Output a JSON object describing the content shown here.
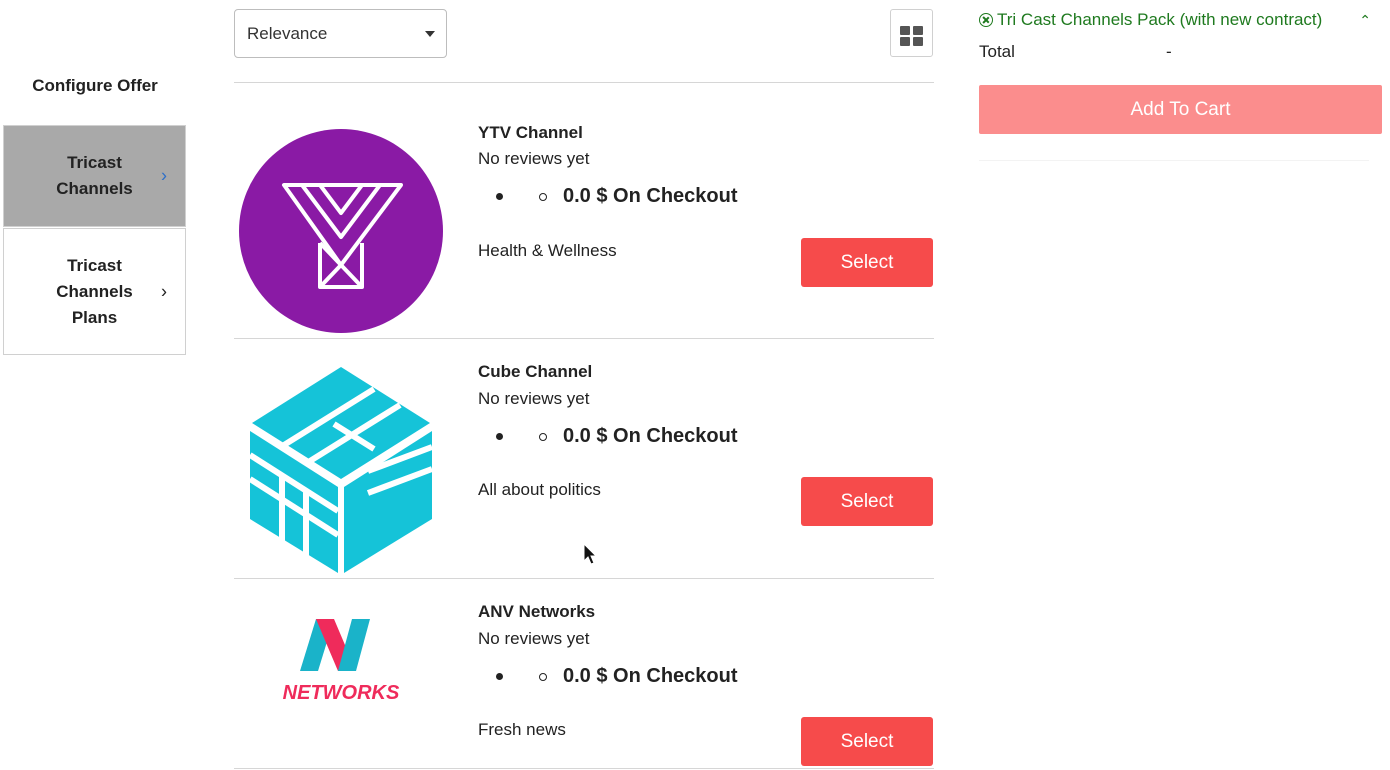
{
  "sidebar": {
    "title": "Configure Offer",
    "items": [
      {
        "label": "Tricast Channels",
        "active": true
      },
      {
        "label": "Tricast Channels Plans",
        "active": false
      }
    ]
  },
  "toolbar": {
    "sort_value": "Relevance",
    "view_icon": "grid-view-icon"
  },
  "products": [
    {
      "name": "YTV Channel",
      "reviews": "No reviews yet",
      "price": "0.0 $ On Checkout",
      "description": "Health & Wellness",
      "select_label": "Select",
      "logo": "ytv-logo",
      "logo_color": "#8a1aa5"
    },
    {
      "name": "Cube Channel",
      "reviews": "No reviews yet",
      "price": "0.0 $ On Checkout",
      "description": "All about politics",
      "select_label": "Select",
      "logo": "cube-logo",
      "logo_color": "#15c3d8"
    },
    {
      "name": "ANV Networks",
      "reviews": "No reviews yet",
      "price": "0.0 $ On Checkout",
      "description": "Fresh news",
      "select_label": "Select",
      "logo": "anv-networks-logo",
      "logo_color": "#ef2b5b",
      "logo_text": "NETWORKS"
    }
  ],
  "cart": {
    "offer_name": "Tri Cast Channels Pack (with new contract)",
    "total_label": "Total",
    "total_value": "-",
    "add_to_cart_label": "Add To Cart"
  },
  "colors": {
    "accent": "#f64b4b",
    "accent_disabled": "#fb8d8d",
    "offer_green": "#1f7a1f",
    "sidebar_active": "#a9a9a9"
  }
}
